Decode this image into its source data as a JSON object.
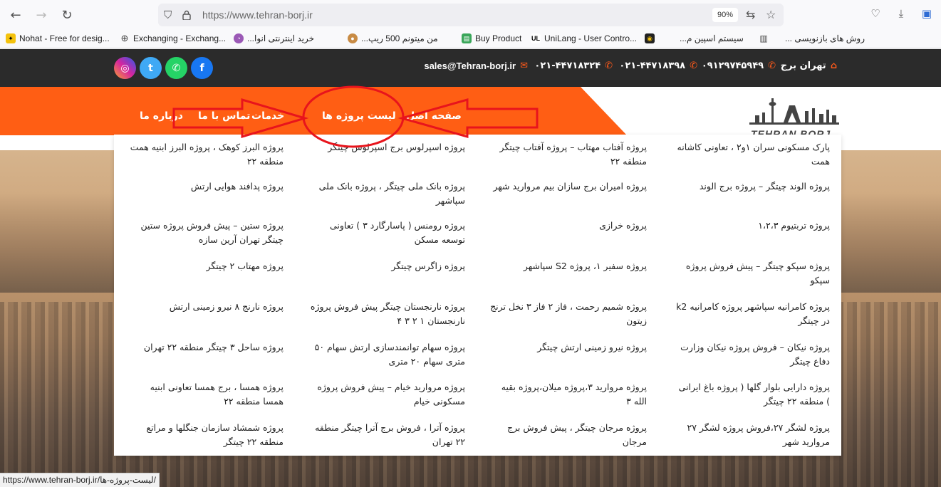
{
  "browser": {
    "url": "https://www.tehran-borj.ir",
    "zoom": "90%",
    "bookmarks": [
      "Nohat - Free for desig...",
      "Exchanging - Exchang...",
      "خرید اینترنتی انوا...",
      "من میتونم 500 ریپ...",
      "Buy Product",
      "UniLang - User Contro...",
      "سیستم اسپین م...",
      "روش های بازنویسی ..."
    ]
  },
  "topbar": {
    "city": "تهران برج",
    "mobile": "۰۹۱۲۹۷۴۵۹۴۹",
    "phone1": "۰۲۱-۴۴۷۱۸۳۹۸",
    "phone2": "۰۲۱-۴۴۷۱۸۳۲۴",
    "email": "sales@Tehran-borj.ir"
  },
  "menu": {
    "home": "صفحه اصل",
    "projects": "لیست پروژه ها",
    "services": "خدمات",
    "contact": "تماس با ما",
    "about": "درباره ما"
  },
  "logo": {
    "text": "TEHRAN BORJ"
  },
  "projects": {
    "col1": [
      "پارک مسکونی سران ۱و۲ ، تعاونی کاشانه همت",
      "پروژه الوند چیتگر – پروژه برج الوند",
      "پروژه تربتیوم ۱،۲،۳",
      "پروژه سپکو چیتگر – پیش فروش پروژه سپکو",
      "پروژه کامرانیه سپاشهر پروژه کامرانیه k2 در چیتگر",
      "پروژه نیکان – فروش پروژه نیکان وزارت دفاع چیتگر",
      "پروژه دارایی بلوار گلها ( پروژه باغ ایرانی ) منطقه ۲۲ چیتگر",
      "پروژه لشگر ۲۷،فروش پروژه لشگر ۲۷ مروارید شهر"
    ],
    "col2": [
      "پروژه آفتاب مهتاب – پروژه آفتاب چیتگر منطقه ۲۲",
      "پروژه امیران برج سازان بیم مروارید شهر",
      "پروژه خرازی",
      "پروژه سفیر ۱، پروژه S2 سپاشهر",
      "پروژه شمیم رحمت ، فاز ۲ فاز ۳ نخل ترنج زیتون",
      "پروژه نیرو زمینی ارتش چیتگر",
      "پروژه مروارید ۳،پروژه میلان،پروژه بقیه الله ۳",
      "پروژه مرجان چیتگر ، پیش فروش برج مرجان"
    ],
    "col3": [
      "پروژه اسپرلوس برج اسپرلوس چیتگر",
      "پروژه بانک ملی چیتگر ، پروژه بانک ملی سپاشهر",
      "پروژه رومنس ( پاسارگارد ۳ ) تعاونی توسعه مسکن",
      "پروژه زاگرس چیتگر",
      "پروژه نارنجستان چیتگر پیش فروش پروژه نارنجستان ۱ ۲ ۳ ۴",
      "پروژه سهام توانمندسازی ارتش سهام ۵۰ متری سهام ۲۰ متری",
      "پروژه مروارید خیام – پیش فروش پروژه مسکونی خیام",
      "پروژه آترا ، فروش برج آترا چیتگر منطقه ۲۲ تهران"
    ],
    "col4": [
      "پروژه البرز کوهک ، پروژه البرز ابنیه همت منطقه ۲۲",
      "پروژه پدافند هوایی ارتش",
      "پروژه ستین – پیش فروش پروژه ستین چیتگر تهران آرین سازه",
      "پروژه مهتاب ۲ چیتگر",
      "پروژه نارنج ۸ نیرو زمینی ارتش",
      "پروژه ساحل ۳ چیتگر منطقه ۲۲ تهران",
      "پروژه همسا ، برج همسا تعاونی ابنیه همسا منطقه ۲۲",
      "پروژه شمشاد سازمان جنگلها و مراتع منطقه ۲۲ چیتگر"
    ]
  },
  "status_url": "https://www.tehran-borj.ir/لیست-پروژه-ها/",
  "colors": {
    "accent": "#ff5e14",
    "annotation": "#e8141c",
    "topbar": "#2b2b2b"
  }
}
